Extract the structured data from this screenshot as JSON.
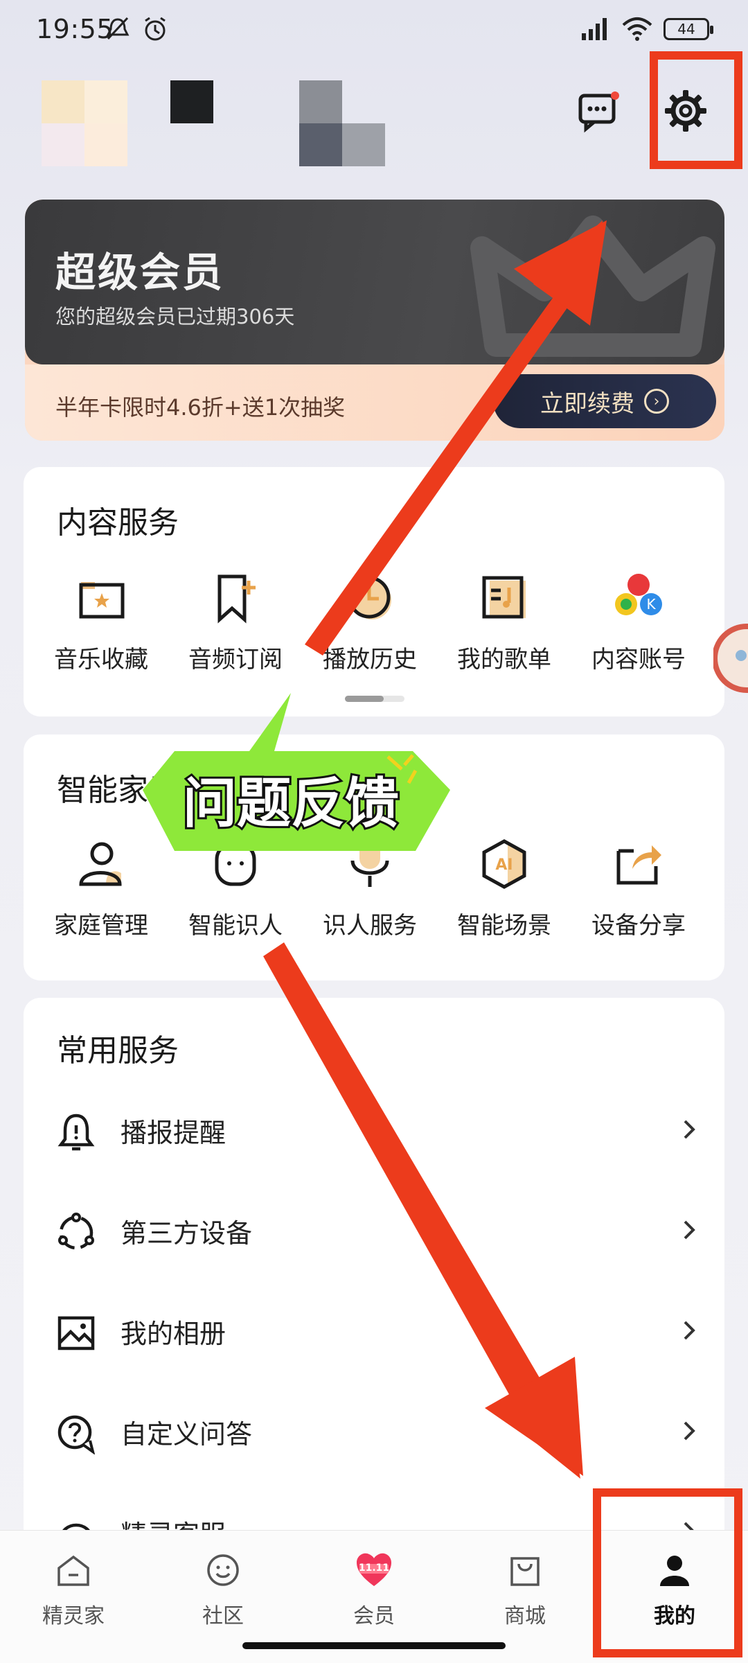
{
  "status_bar": {
    "time": "19:55",
    "battery": "44"
  },
  "vip": {
    "title": "超级会员",
    "subtitle": "您的超级会员已过期306天",
    "promo": "半年卡限时4.6折+送1次抽奖",
    "renew_label": "立即续费"
  },
  "content_services": {
    "title": "内容服务",
    "items": [
      {
        "label": "音乐收藏",
        "icon": "music-folder-icon"
      },
      {
        "label": "音频订阅",
        "icon": "bookmark-add-icon"
      },
      {
        "label": "播放历史",
        "icon": "clock-icon"
      },
      {
        "label": "我的歌单",
        "icon": "playlist-icon"
      },
      {
        "label": "内容账号",
        "icon": "content-account-icon"
      }
    ]
  },
  "smart_home": {
    "title": "智能家居",
    "items": [
      {
        "label": "家庭管理",
        "icon": "user-icon"
      },
      {
        "label": "智能识人",
        "icon": "face-icon"
      },
      {
        "label": "识人服务",
        "icon": "mic-icon"
      },
      {
        "label": "智能场景",
        "icon": "ai-hexagon-icon"
      },
      {
        "label": "设备分享",
        "icon": "share-icon"
      }
    ]
  },
  "common_services": {
    "title": "常用服务",
    "items": [
      {
        "label": "播报提醒",
        "icon": "bell-icon"
      },
      {
        "label": "第三方设备",
        "icon": "devices-icon"
      },
      {
        "label": "我的相册",
        "icon": "image-icon"
      },
      {
        "label": "自定义问答",
        "icon": "qa-icon"
      },
      {
        "label": "精灵客服",
        "icon": "headset-icon"
      }
    ]
  },
  "bottom_nav": [
    {
      "label": "精灵家",
      "icon": "home-icon"
    },
    {
      "label": "社区",
      "icon": "smile-icon"
    },
    {
      "label": "会员",
      "icon": "vip-heart-icon",
      "badge": "11.11"
    },
    {
      "label": "商城",
      "icon": "shopping-bag-icon"
    },
    {
      "label": "我的",
      "icon": "profile-icon",
      "active": true
    }
  ],
  "annotation": {
    "callout_text": "问题反馈"
  },
  "colors": {
    "accent_orange": "#e8a24a",
    "annotation_red": "#ec3b1c",
    "callout_green": "#8ee83a"
  }
}
